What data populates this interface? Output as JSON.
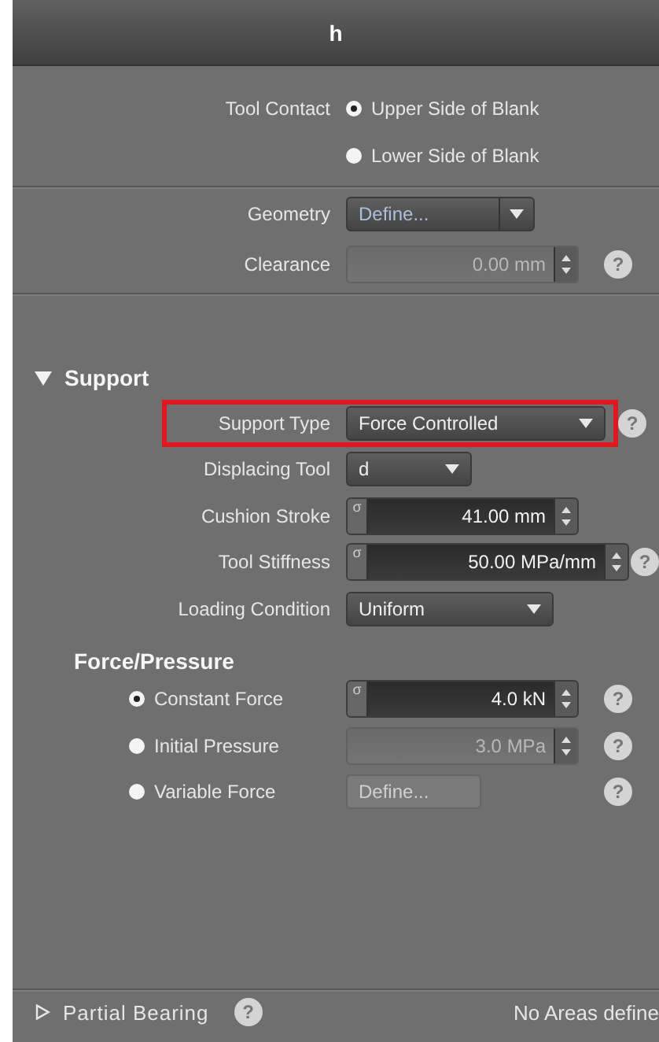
{
  "header": {
    "title": "h"
  },
  "tool_contact": {
    "label": "Tool Contact",
    "options": [
      {
        "label": "Upper Side of Blank",
        "selected": true
      },
      {
        "label": "Lower Side of Blank",
        "selected": false
      }
    ]
  },
  "fields": [
    {
      "label": "Geometry",
      "kind": "split",
      "value": "Define..."
    },
    {
      "label": "Clearance",
      "kind": "spinner",
      "value": "0.00 mm",
      "disabled": true,
      "help": "?"
    }
  ],
  "support": {
    "title": "Support",
    "expanded": true,
    "fields": [
      {
        "label": "Support Type",
        "kind": "select",
        "value": "Force Controlled",
        "disabled": false,
        "help": "?",
        "highlighted": true
      },
      {
        "label": "Displacing Tool",
        "kind": "select",
        "value": "d",
        "disabled": false,
        "highlighted": false
      },
      {
        "label": "Cushion Stroke",
        "kind": "spinner",
        "value": "41.00 mm",
        "prefix": "σ",
        "disabled": false,
        "highlighted": false
      },
      {
        "label": "Tool Stiffness",
        "kind": "spinner",
        "value": "50.00 MPa/mm",
        "prefix": "σ",
        "disabled": false,
        "help": "?",
        "highlighted": false
      },
      {
        "label": "Loading Condition",
        "kind": "select",
        "value": "Uniform",
        "disabled": false,
        "highlighted": false
      }
    ],
    "force_pressure": {
      "title": "Force/Pressure",
      "options": [
        {
          "label": "Constant Force",
          "selected": true,
          "kind": "spinner",
          "value": "4.0 kN",
          "prefix": "σ",
          "disabled": false,
          "help": "?"
        },
        {
          "label": "Initial Pressure",
          "selected": false,
          "kind": "spinner",
          "value": "3.0 MPa",
          "disabled": true,
          "help": "?"
        },
        {
          "label": "Variable Force",
          "selected": false,
          "kind": "button",
          "value": "Define...",
          "disabled": true,
          "help": "?"
        }
      ]
    }
  },
  "partial_bearing": {
    "title": "Partial Bearing",
    "expanded": false,
    "help": "?",
    "status": "No Areas define"
  }
}
